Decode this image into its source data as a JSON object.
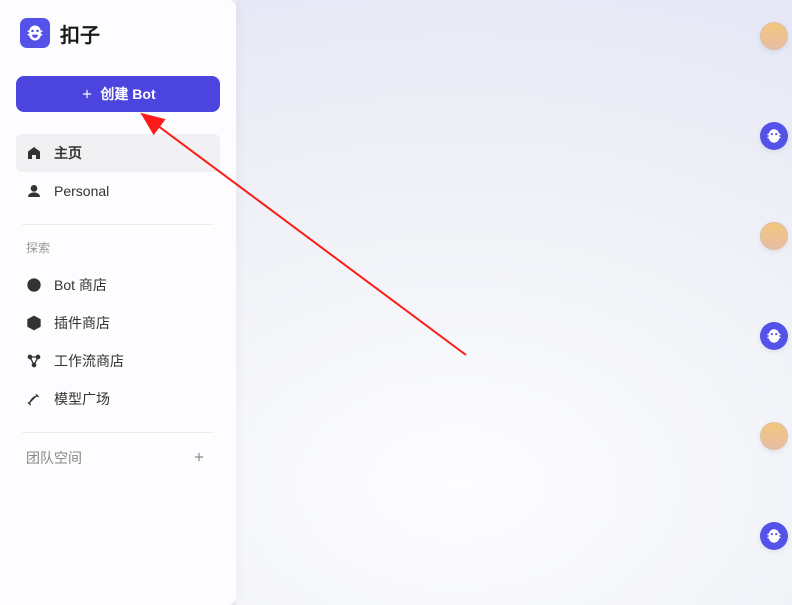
{
  "brand": {
    "title": "扣子"
  },
  "sidebar": {
    "create_label": "创建 Bot",
    "home_label": "主页",
    "personal_label": "Personal",
    "explore_header": "探索",
    "explore_items": {
      "bot_store": "Bot 商店",
      "plugin_store": "插件商店",
      "workflow_store": "工作流商店",
      "model_square": "模型广场"
    },
    "team_header": "团队空间"
  }
}
